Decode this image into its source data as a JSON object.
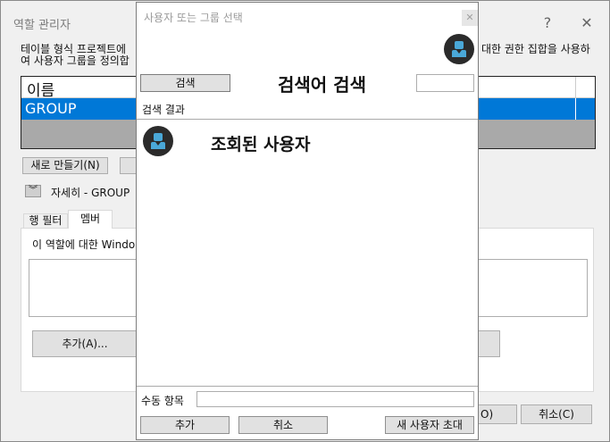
{
  "background_window": {
    "title": "역할 관리자",
    "help_glyph": "?",
    "close_glyph": "✕",
    "description_line1": "테이블 형식 프로젝트에",
    "description_line1_right": "대한 권한 집합을 사용하",
    "description_line2": "여 사용자 그룹을 정의합",
    "list_header": "이름",
    "list_selected_row": "GROUP",
    "new_button": "새로 만들기(N)",
    "details_label": "자세히 - GROUP",
    "tabs": [
      "행 필터",
      "멤버"
    ],
    "members_description": "이 역할에 대한 Windo",
    "add_button": "추가(A)...",
    "ok_button_partial": "O)",
    "cancel_button": "취소(C)"
  },
  "dialog": {
    "title": "사용자 또는 그룹 선택",
    "close_glyph": "✕",
    "search_button": "검색",
    "search_placeholder_text": "검색어 검색",
    "results_label": "검색 결과",
    "result_user": "조회된 사용자",
    "manual_entry_label": "수동 항목",
    "add_button": "추가",
    "cancel_button": "취소",
    "invite_button": "새 사용자 초대"
  },
  "colors": {
    "selection": "#0078d7",
    "avatar_bg": "#2b2b2b",
    "avatar_fg": "#4aa8d8"
  }
}
